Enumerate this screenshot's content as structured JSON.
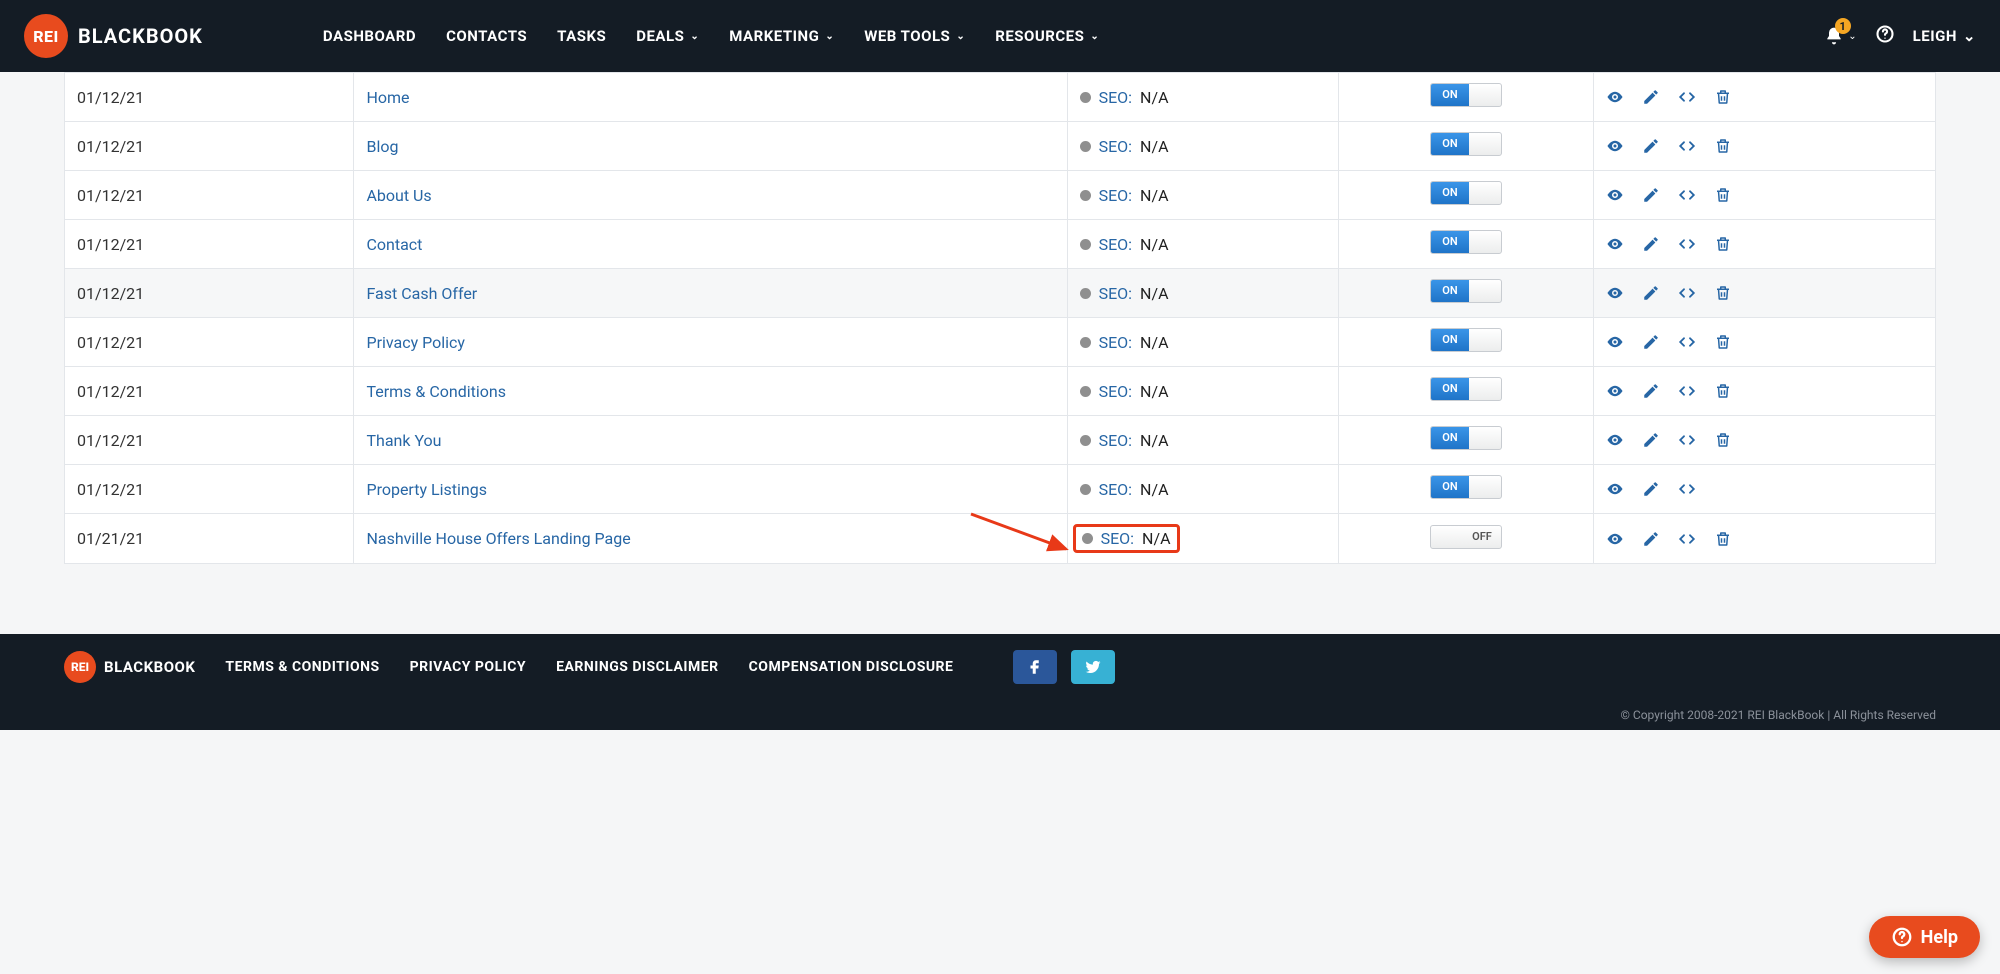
{
  "brand": {
    "short": "REI",
    "full": "BLACKBOOK"
  },
  "nav": {
    "dashboard": "DASHBOARD",
    "contacts": "CONTACTS",
    "tasks": "TASKS",
    "deals": "DEALS",
    "marketing": "MARKETING",
    "webtools": "WEB TOOLS",
    "resources": "RESOURCES"
  },
  "notifications": {
    "count": "1"
  },
  "user": {
    "name": "LEIGH"
  },
  "toggle_labels": {
    "on": "ON",
    "off": "OFF"
  },
  "seo_label": "SEO:",
  "rows": [
    {
      "date": "01/12/21",
      "page": "Home",
      "seo": "N/A",
      "state": "on",
      "shade": false,
      "has_delete": true,
      "highlight": false
    },
    {
      "date": "01/12/21",
      "page": "Blog",
      "seo": "N/A",
      "state": "on",
      "shade": false,
      "has_delete": true,
      "highlight": false
    },
    {
      "date": "01/12/21",
      "page": "About Us",
      "seo": "N/A",
      "state": "on",
      "shade": false,
      "has_delete": true,
      "highlight": false
    },
    {
      "date": "01/12/21",
      "page": "Contact",
      "seo": "N/A",
      "state": "on",
      "shade": false,
      "has_delete": true,
      "highlight": false
    },
    {
      "date": "01/12/21",
      "page": "Fast Cash Offer",
      "seo": "N/A",
      "state": "on",
      "shade": true,
      "has_delete": true,
      "highlight": false
    },
    {
      "date": "01/12/21",
      "page": "Privacy Policy",
      "seo": "N/A",
      "state": "on",
      "shade": false,
      "has_delete": true,
      "highlight": false
    },
    {
      "date": "01/12/21",
      "page": "Terms & Conditions",
      "seo": "N/A",
      "state": "on",
      "shade": false,
      "has_delete": true,
      "highlight": false
    },
    {
      "date": "01/12/21",
      "page": "Thank You",
      "seo": "N/A",
      "state": "on",
      "shade": false,
      "has_delete": true,
      "highlight": false
    },
    {
      "date": "01/12/21",
      "page": "Property Listings",
      "seo": "N/A",
      "state": "on",
      "shade": false,
      "has_delete": false,
      "highlight": false
    },
    {
      "date": "01/21/21",
      "page": "Nashville House Offers Landing Page",
      "seo": "N/A",
      "state": "off",
      "shade": false,
      "has_delete": true,
      "highlight": true
    }
  ],
  "footer": {
    "terms": "TERMS & CONDITIONS",
    "privacy": "PRIVACY POLICY",
    "earnings": "EARNINGS DISCLAIMER",
    "compensation": "COMPENSATION DISCLOSURE",
    "copyright": "© Copyright 2008-2021 REI BlackBook | All Rights Reserved"
  },
  "help": {
    "label": "Help"
  }
}
